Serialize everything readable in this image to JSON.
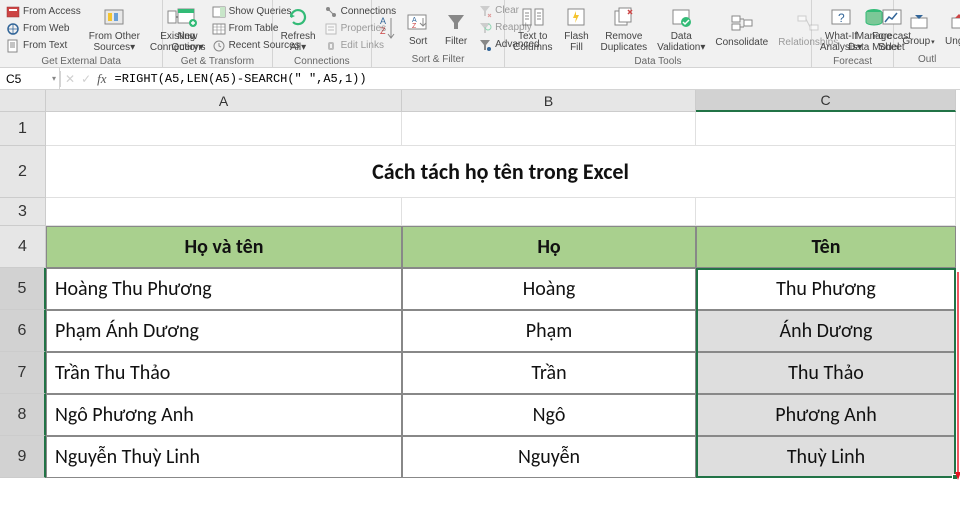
{
  "ribbon": {
    "groups": {
      "getext": {
        "label": "Get External Data",
        "access": "From Access",
        "web": "From Web",
        "text": "From Text",
        "other": "From Other\nSources",
        "existing": "Existing\nConnections"
      },
      "transform": {
        "label": "Get & Transform",
        "newquery": "New\nQuery",
        "show": "Show Queries",
        "table": "From Table",
        "recent": "Recent Sources"
      },
      "connections": {
        "label": "Connections",
        "refresh": "Refresh\nAll",
        "conns": "Connections",
        "props": "Properties",
        "edit": "Edit Links"
      },
      "sortfilter": {
        "label": "Sort & Filter",
        "sort": "Sort",
        "filter": "Filter",
        "clear": "Clear",
        "reapply": "Reapply",
        "advanced": "Advanced"
      },
      "datatools": {
        "label": "Data Tools",
        "ttc": "Text to\nColumns",
        "flash": "Flash\nFill",
        "dup": "Remove\nDuplicates",
        "valid": "Data\nValidation",
        "consol": "Consolidate",
        "rel": "Relationships",
        "model": "Manage\nData Model"
      },
      "forecast": {
        "label": "Forecast",
        "whatif": "What-If\nAnalysis",
        "sheet": "Forecast\nSheet"
      },
      "outline": {
        "label": "Outl",
        "group": "Group",
        "ungroup": "Ungro"
      }
    }
  },
  "namebox": "C5",
  "formula": "=RIGHT(A5,LEN(A5)-SEARCH(\" \",A5,1))",
  "columns": [
    "A",
    "B",
    "C"
  ],
  "rowHeights": {
    "title": 52
  },
  "title": "Cách tách họ tên trong Excel",
  "headers": {
    "a": "Họ và tên",
    "b": "Họ",
    "c": "Tên"
  },
  "data": [
    {
      "a": "Hoàng Thu Phương",
      "b": "Hoàng",
      "c": "Thu Phương"
    },
    {
      "a": "Phạm Ánh Dương",
      "b": "Phạm",
      "c": "Ánh Dương"
    },
    {
      "a": "Trần Thu Thảo",
      "b": "Trần",
      "c": "Thu Thảo"
    },
    {
      "a": "Ngô Phương Anh",
      "b": "Ngô",
      "c": "Phương Anh"
    },
    {
      "a": "Nguyễn Thuỳ Linh",
      "b": "Nguyễn",
      "c": "Thuỳ Linh"
    }
  ],
  "colWidths": {
    "A": 356,
    "B": 294,
    "C": 260
  },
  "rowH": {
    "default": 42,
    "hdr": 42,
    "r1": 34,
    "r2": 52,
    "r3": 28
  }
}
